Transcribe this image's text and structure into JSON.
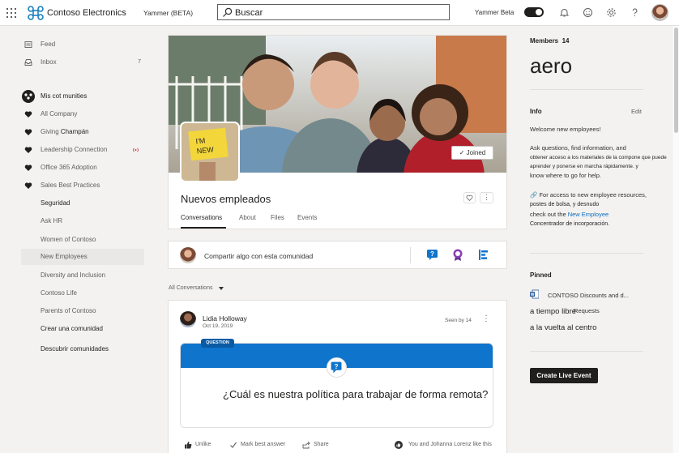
{
  "topbar": {
    "brand": "Contoso Electronics",
    "app_name": "Yammer (BETA)",
    "search_placeholder": "Buscar",
    "beta_label": "Yammer Beta"
  },
  "nav": {
    "feed": "Feed",
    "inbox": "Inbox",
    "inbox_count": "7",
    "my_communities": "Mis cot munities",
    "items": [
      {
        "label": "All Company",
        "icon": "heart-icon"
      },
      {
        "label": "Giving ",
        "label_b": "Champán",
        "icon": "heart-icon"
      },
      {
        "label": "Leadership Connection",
        "icon": "heart-icon"
      },
      {
        "label": "Office 365 Adoption",
        "icon": "heart-icon"
      },
      {
        "label": "Sales Best Practices",
        "icon": "heart-icon"
      }
    ],
    "plain_items": [
      "Seguridad",
      "Ask HR",
      "Women of Contoso",
      "New Employees",
      "Diversity and Inclusion",
      "Contoso Life",
      "Parents of Contoso"
    ],
    "create_community": "Crear una comunidad",
    "discover_communities": "Descubrir comunidades"
  },
  "group": {
    "title": "Nuevos empleados",
    "avatar_text_1": "I'M",
    "avatar_text_2": "NEW",
    "joined_label": "Joined",
    "tabs": [
      "Conversations",
      "About",
      "Files",
      "Events"
    ]
  },
  "composer": {
    "placeholder": "Compartir algo con esta comunidad"
  },
  "feed_filter": "All Conversations",
  "post": {
    "author": "Lidia Holloway",
    "date": "Oct 19, 2019",
    "seen": "Seen by 14",
    "tag": "QUESTION",
    "question": "¿Cuál es nuestra política para trabajar de forma remota?",
    "actions": {
      "like": "Unlike",
      "best_answer": "Mark best answer",
      "share": "Share",
      "likes_summary": "You and Johanna Lorenz like this"
    }
  },
  "right": {
    "members_label": "Members",
    "members_count": "14",
    "big_text": "aero",
    "info_label": "Info",
    "edit_label": "Edit",
    "welcome": "Welcome new employees!",
    "info_para_1": "Ask questions, find information, and",
    "info_para_2": "obtener acceso a los materiales de la compone que puede aprender y ponerse en marcha rápidamente. y",
    "info_para_3": "know where to go for help.",
    "info_para_4": "For access to new employee resources,",
    "info_para_5": "postes de bolsa, y desnudo",
    "info_para_6": "check out the",
    "info_link": "New Employee",
    "info_para_7": "Concentrador de incorporación.",
    "pinned_label": "Pinned",
    "pinned_1": "CONTOSO Discounts and d...",
    "pinned_2a": "a tiempo libre",
    "pinned_2b": "Requests",
    "pinned_3": "a la vuelta al centro",
    "live_event_button": "Create Live Event"
  },
  "colors": {
    "accent_blue": "#0f74cc",
    "dark": "#201f1e",
    "link": "#0f6cbd"
  }
}
